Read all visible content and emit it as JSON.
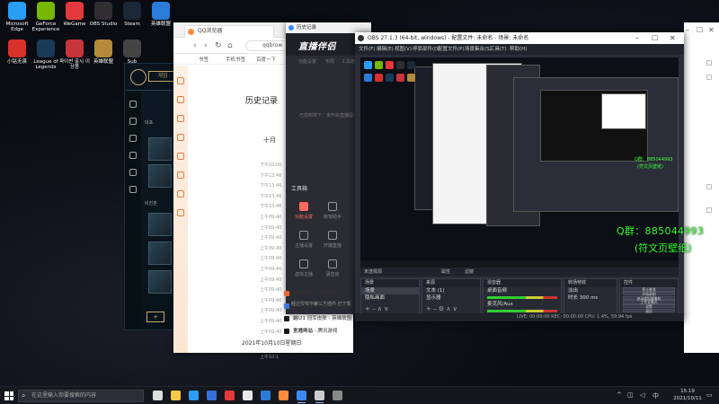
{
  "desktop_icons": [
    {
      "label": "Microsoft Edge",
      "color": "#2a9df4"
    },
    {
      "label": "GeForce Experience",
      "color": "#76b900"
    },
    {
      "label": "WeGame",
      "color": "#e4393c"
    },
    {
      "label": "OBS Studio",
      "color": "#302e31"
    },
    {
      "label": "Steam",
      "color": "#1b2838"
    },
    {
      "label": "英雄联盟",
      "color": "#2b7bd9"
    },
    {
      "label": "小铭无畏",
      "color": "#d9302a"
    },
    {
      "label": "League of Legends",
      "color": "#1a3a5a"
    },
    {
      "label": "파이썬 출시 이상품",
      "color": "#c7343a"
    },
    {
      "label": "英雄联盟",
      "color": "#b48b3a"
    },
    {
      "label": "Sub",
      "color": "#444"
    }
  ],
  "lol_client": {
    "play_label": "개임",
    "section1": "대포",
    "section2": "비전판"
  },
  "browser": {
    "tab_title": "QQ浏览器",
    "address": "qqbrow",
    "bookmarks": [
      "书签",
      "手机书签",
      "百度一下"
    ],
    "history_title": "历史记录",
    "month_label": "十月",
    "times": [
      "下午02:00",
      "下午13:46",
      "下午13:46",
      "下午13:46",
      "下午13:46",
      "上午09:40",
      "上午09:40",
      "上午09:40",
      "上午09:40",
      "上午09:40",
      "上午09:40",
      "上午09:40",
      "上午09:40",
      "上午09:40",
      "上午09:40",
      "上午09:40",
      "上午09:40"
    ],
    "date_label": "2021年10月10日星期日",
    "time_2": "上午10:1",
    "time_3": "上午10:1"
  },
  "zhibo": {
    "window_title": "历史记录",
    "logo": "直播伴侣",
    "menu": [
      "功能设置",
      "布局",
      "工具箱"
    ],
    "message": "已拍到地下：未开启直播提示",
    "tools_title": "工具箱",
    "tools": [
      {
        "label": "功能设置",
        "active": true
      },
      {
        "label": "房管助手",
        "active": false
      },
      {
        "label": "主播设置",
        "active": false
      },
      {
        "label": "开播直播",
        "active": false
      },
      {
        "label": "虚拟主播",
        "active": false
      },
      {
        "label": "语音房",
        "active": false
      }
    ],
    "tip": "经过授权中第三方插件 已下载"
  },
  "browser_list": [
    {
      "label": "虾米盒子 - 搜狗搜索",
      "color": "#e66b2f"
    },
    {
      "label": "上网导航 - 轻快上网 从这开始",
      "color": "#3a7be0"
    },
    {
      "label": "2021 冠军皮肤 - 英雄联盟官方网站 - 腾讯游戏",
      "color": "#1a1a1a"
    },
    {
      "label": "主播中心",
      "color": "#1a1a1a"
    }
  ],
  "obs": {
    "title": "OBS 27.1.3 (64-bit, windows) - 配置文件: 未命名 - 场景: 未命名",
    "menu": [
      "文件(F)",
      "编辑(E)",
      "视图(V)",
      "停靠部件(D)",
      "配置文件(P)",
      "场景集合(S)",
      "工具(T)",
      "帮助(H)"
    ],
    "no_source": "未选择源",
    "props_label": "属性",
    "filters_label": "滤镜",
    "scenes_header": "场景",
    "scenes": [
      "场景",
      "隐私画面"
    ],
    "sources_header": "来源",
    "sources": [
      "文本 (1)",
      "显示器"
    ],
    "mixer_header": "混音器",
    "mixer": [
      {
        "name": "桌面音频",
        "db": "0.0 dB"
      },
      {
        "name": "麦克风/Aux",
        "db": "0.0 dB"
      }
    ],
    "transition_header": "转场特效",
    "transition_type": "淡出",
    "duration_label": "时长",
    "duration": "300 ms",
    "controls_header": "控件",
    "controls": [
      "停止推流",
      "开始录制",
      "启动虚拟摄像机",
      "工作室模式",
      "设置",
      "退出"
    ],
    "status": "LIVE: 00:00:00  REC: 00:00:00  CPU: 1.4%, 59.94 fps"
  },
  "overlay": {
    "qq_group": "Q群：885044993",
    "sub": "(符文页壁纸)",
    "preview_qq": "Q群：885044993",
    "preview_sub": "(符文页壁纸)"
  },
  "taskbar": {
    "search_placeholder": "在这里输入你要搜索的内容",
    "icons": [
      {
        "name": "task-view-icon",
        "color": "#ddd",
        "active": false
      },
      {
        "name": "file-explorer-icon",
        "color": "#f7c948",
        "active": false
      },
      {
        "name": "edge-icon",
        "color": "#2a9df4",
        "active": false
      },
      {
        "name": "store-icon",
        "color": "#3a6fd8",
        "active": false
      },
      {
        "name": "wegame-icon",
        "color": "#e4393c",
        "active": false
      },
      {
        "name": "qq-icon",
        "color": "#e8e8e8",
        "active": false
      },
      {
        "name": "lol-icon",
        "color": "#2b7bd9",
        "active": false
      },
      {
        "name": "orange-app-icon",
        "color": "#ff8a3d",
        "active": false
      },
      {
        "name": "zhibo-icon",
        "color": "#3c89f5",
        "active": true
      },
      {
        "name": "obs-icon",
        "color": "#cccccc",
        "active": true
      },
      {
        "name": "extra-app-icon",
        "color": "#888888",
        "active": false
      }
    ],
    "time": "15:19",
    "date": "2021/10/11"
  }
}
